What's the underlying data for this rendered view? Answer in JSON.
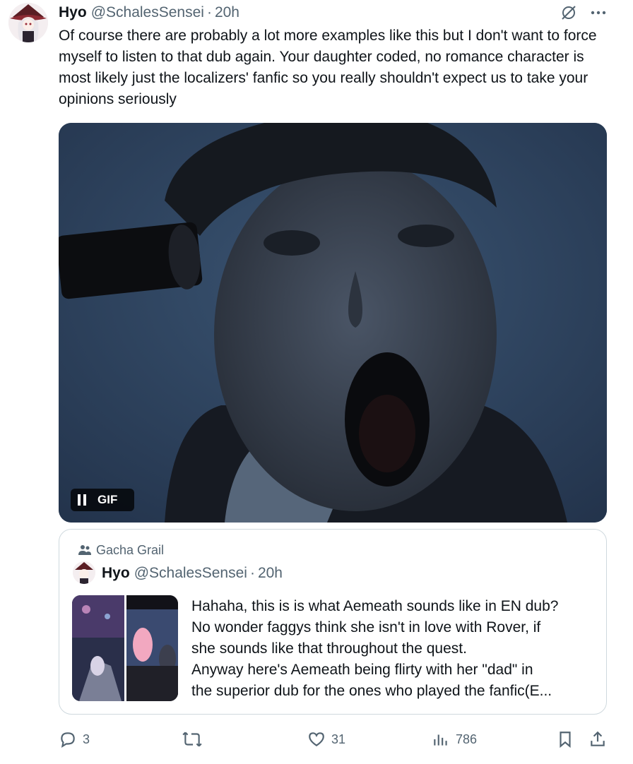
{
  "tweet": {
    "name": "Hyo",
    "handle": "@SchalesSensei",
    "dot": "·",
    "time": "20h",
    "text": "Of course there are probably a lot more examples like this but I don't want to force myself to listen to that dub again. Your daughter coded, no romance character is most likely just the localizers' fanfic so you really shouldn't expect us to take your opinions seriously",
    "gif_label": "GIF",
    "icons": {
      "grok": "grok-icon",
      "more": "more-icon",
      "pause": "pause-icon"
    }
  },
  "quote": {
    "community": "Gacha Grail",
    "name": "Hyo",
    "handle": "@SchalesSensei",
    "dot": "·",
    "time": "20h",
    "lines": [
      "Hahaha, this is is what Aemeath sounds like in EN dub?",
      "No wonder faggys think she isn't in love with Rover, if",
      "she sounds like that throughout the quest.",
      "Anyway here's Aemeath being flirty with her \"dad\" in",
      "the superior dub for the ones who played the fanfic(E..."
    ]
  },
  "actions": {
    "replies": "3",
    "reposts": "",
    "likes": "31",
    "views": "786",
    "icons": [
      "reply-icon",
      "repost-icon",
      "like-icon",
      "views-icon",
      "bookmark-icon",
      "share-icon"
    ]
  },
  "colors": {
    "text": "#0f1419",
    "secondary": "#536471",
    "border": "#cfd9de"
  }
}
